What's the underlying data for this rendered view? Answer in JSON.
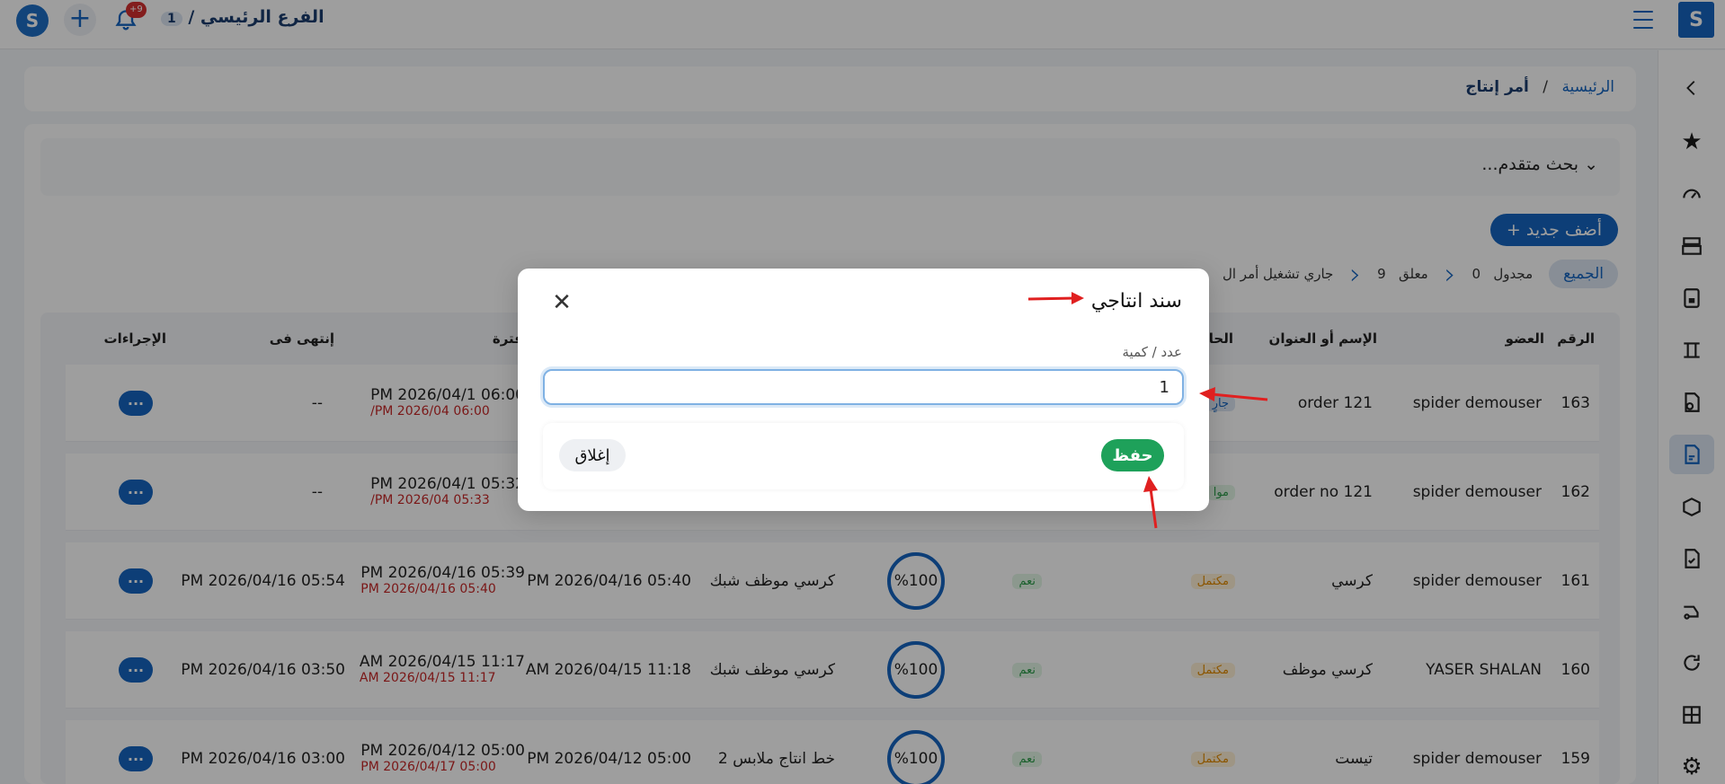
{
  "topbar": {
    "logo_glyph": "S",
    "branch_label": "الفرع الرئيسي /",
    "branch_num": "1",
    "bell_badge": "+9"
  },
  "breadcrumb": {
    "home": "الرئيسية",
    "separator": "/",
    "current": "أمر إنتاج"
  },
  "advanced_search": "بحث متقدم...",
  "add_new": "+ أضف جديد",
  "filters": {
    "all": "الجميع",
    "scheduled": "مجدول",
    "scheduled_count": "0",
    "closed": "معلق",
    "closed_count": "9",
    "running": "جاري تشغيل أمر ال"
  },
  "table": {
    "headers": {
      "num": "الرقم",
      "member": "العضو",
      "name": "الإسم أو العنوان",
      "status": "الحا",
      "period": "فترة",
      "ended": "إنتهى فى",
      "actions": "الإجراءات"
    },
    "rows": [
      {
        "num": "163",
        "member": "spider demouser",
        "name": "order 121",
        "status": "جارٍ",
        "line": "",
        "circle": "",
        "period_a": "",
        "period_b": "06:00 PM 2026/04/1",
        "period_c": "06:00 PM 2026/04/",
        "ended": "--",
        "approved": ""
      },
      {
        "num": "162",
        "member": "spider demouser",
        "name": "order no 121",
        "status": "موا",
        "line": "",
        "circle": "",
        "period_a": "",
        "period_b": "05:32 PM 2026/04/1",
        "period_c": "05:33 PM 2026/04/",
        "ended": "--",
        "approved": ""
      },
      {
        "num": "161",
        "member": "spider demouser",
        "name": "كرسي",
        "status": "مكتمل",
        "line": "كرسي موظف شبك",
        "circle": "%100",
        "period_a": "05:40 PM 2026/04/16",
        "period_b": "05:39 PM 2026/04/16",
        "period_c": "05:40 PM 2026/04/16",
        "ended": "05:54 PM 2026/04/16",
        "approved": "نعم"
      },
      {
        "num": "160",
        "member": "YASER SHALAN",
        "name": "كرسي موظف",
        "status": "مكتمل",
        "line": "كرسي موظف شبك",
        "circle": "%100",
        "period_a": "11:18 AM 2026/04/15",
        "period_b": "11:17 AM 2026/04/15",
        "period_c": "11:17 AM 2026/04/15",
        "ended": "03:50 PM 2026/04/16",
        "approved": "نعم"
      },
      {
        "num": "159",
        "member": "spider demouser",
        "name": "تيست",
        "status": "مكتمل",
        "line": "خط انتاج ملابس 2",
        "circle": "%100",
        "period_a": "05:00 PM 2026/04/12",
        "period_b": "05:00 PM 2026/04/12",
        "period_c": "05:00 PM 2026/04/17",
        "ended": "03:00 PM 2026/04/16",
        "approved": "نعم"
      }
    ],
    "actions_label": "···"
  },
  "modal": {
    "title": "سند انتاجي",
    "close_glyph": "✕",
    "field_label": "عدد / كمية",
    "field_value": "1",
    "save": "حفظ",
    "close": "إغلاق"
  },
  "colors": {
    "brand": "#1565c0",
    "save": "#1ea15a",
    "annotation": "#e02020"
  }
}
